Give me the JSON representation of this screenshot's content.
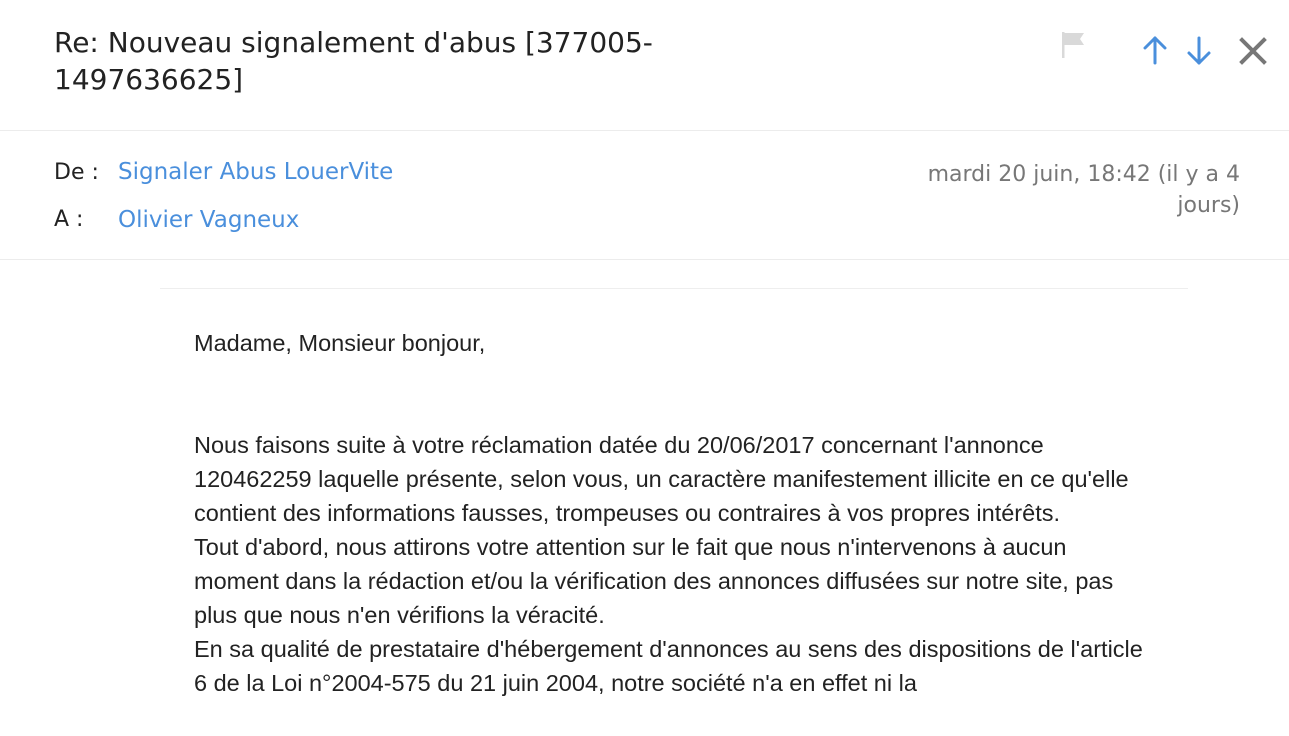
{
  "email": {
    "subject": "Re: Nouveau signalement d'abus [377005-1497636625]",
    "from_label": "De :",
    "from_name": "Signaler Abus LouerVite",
    "to_label": "A :",
    "to_name": "Olivier Vagneux",
    "date": "mardi 20 juin, 18:42 (il y a 4 jours)"
  },
  "toolbar": {
    "flag_icon": "flag-icon",
    "prev_icon": "arrow-up-icon",
    "next_icon": "arrow-down-icon",
    "close_icon": "close-icon"
  },
  "body": {
    "greeting": "Madame, Monsieur bonjour,",
    "paragraphs": [
      "Nous faisons suite à votre réclamation datée du 20/06/2017 concernant l'annonce 120462259 laquelle présente, selon vous, un caractère manifestement illicite en ce qu'elle contient des informations fausses, trompeuses ou contraires à vos propres intérêts.",
      "Tout d'abord, nous attirons votre attention sur le fait que nous n'intervenons à aucun moment dans la rédaction et/ou la vérification des annonces diffusées sur notre site, pas plus que nous n'en vérifions la véracité.",
      "En sa qualité de prestataire d'hébergement d'annonces au sens des dispositions de l'article 6 de la Loi n°2004-575 du 21 juin 2004, notre société n'a en effet ni la"
    ]
  },
  "colors": {
    "link": "#4a8fdc",
    "nav_arrow": "#4a8fdc",
    "flag": "#d9d9d9",
    "close": "#777777",
    "date_text": "#777777"
  }
}
